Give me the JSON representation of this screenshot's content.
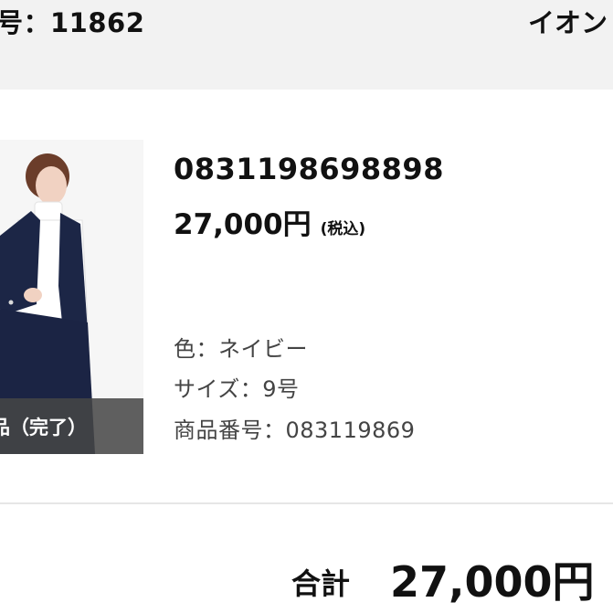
{
  "header": {
    "order_number": "号：11862",
    "store_name": "イオン"
  },
  "item": {
    "status": "品（完了）",
    "code": "0831198698898",
    "price": "27,000円",
    "tax": "(税込)",
    "color": "色：ネイビー",
    "size": "サイズ：9号",
    "product_number": "商品番号：083119869"
  },
  "summary": {
    "total_label": "合計",
    "total_value": "27,000円"
  }
}
